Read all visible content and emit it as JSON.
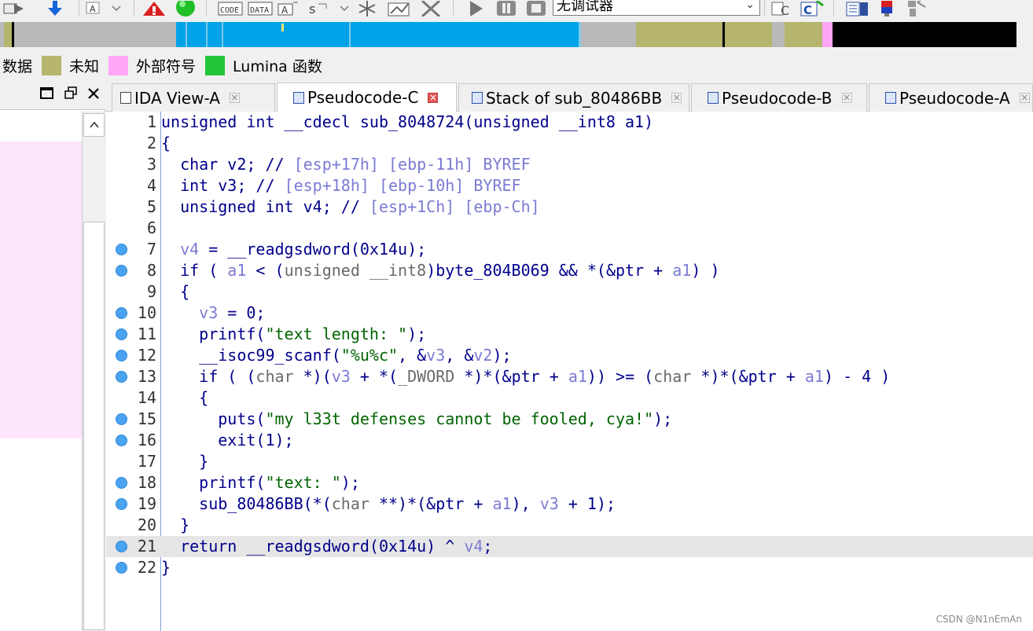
{
  "toolbar": {
    "debugger_select": "无调试器"
  },
  "legend": {
    "items": [
      {
        "label": "数据",
        "color": ""
      },
      {
        "label": "未知",
        "color": "#b5b56e"
      },
      {
        "label": "外部符号",
        "color": "#ffa6f7"
      },
      {
        "label": "Lumina 函数",
        "color": "#22c43a"
      }
    ]
  },
  "tabs": [
    {
      "label": "IDA View-A",
      "active": false
    },
    {
      "label": "Pseudocode-C",
      "active": true
    },
    {
      "label": "Stack of sub_80486BB",
      "active": false
    },
    {
      "label": "Pseudocode-B",
      "active": false
    },
    {
      "label": "Pseudocode-A",
      "active": false
    }
  ],
  "code": {
    "lines": [
      {
        "no": "1",
        "bp": false,
        "text": "unsigned int __cdecl sub_8048724(unsigned __int8 a1)"
      },
      {
        "no": "2",
        "bp": false,
        "text": "{"
      },
      {
        "no": "3",
        "bp": false,
        "text": "  char v2; // [esp+17h] [ebp-11h] BYREF"
      },
      {
        "no": "4",
        "bp": false,
        "text": "  int v3; // [esp+18h] [ebp-10h] BYREF"
      },
      {
        "no": "5",
        "bp": false,
        "text": "  unsigned int v4; // [esp+1Ch] [ebp-Ch]"
      },
      {
        "no": "6",
        "bp": false,
        "text": ""
      },
      {
        "no": "7",
        "bp": true,
        "text": "  v4 = __readgsdword(0x14u);"
      },
      {
        "no": "8",
        "bp": true,
        "text": "  if ( a1 < (unsigned __int8)byte_804B069 && *(&ptr + a1) )"
      },
      {
        "no": "9",
        "bp": false,
        "text": "  {"
      },
      {
        "no": "10",
        "bp": true,
        "text": "    v3 = 0;"
      },
      {
        "no": "11",
        "bp": true,
        "text": "    printf(\"text length: \");"
      },
      {
        "no": "12",
        "bp": true,
        "text": "    __isoc99_scanf(\"%u%c\", &v3, &v2);"
      },
      {
        "no": "13",
        "bp": true,
        "text": "    if ( (char *)(v3 + *(_DWORD *)*(&ptr + a1)) >= (char *)*(&ptr + a1) - 4 )"
      },
      {
        "no": "14",
        "bp": false,
        "text": "    {"
      },
      {
        "no": "15",
        "bp": true,
        "text": "      puts(\"my l33t defenses cannot be fooled, cya!\");"
      },
      {
        "no": "16",
        "bp": true,
        "text": "      exit(1);"
      },
      {
        "no": "17",
        "bp": false,
        "text": "    }"
      },
      {
        "no": "18",
        "bp": true,
        "text": "    printf(\"text: \");"
      },
      {
        "no": "19",
        "bp": true,
        "text": "    sub_80486BB(*(char **)*(&ptr + a1), v3 + 1);"
      },
      {
        "no": "20",
        "bp": false,
        "text": "  }"
      },
      {
        "no": "21",
        "bp": true,
        "text": "  return __readgsdword(0x14u) ^ v4;"
      },
      {
        "no": "22",
        "bp": true,
        "text": "}"
      }
    ],
    "highlighted_line": "21"
  },
  "watermark": "CSDN @N1nEmAn"
}
